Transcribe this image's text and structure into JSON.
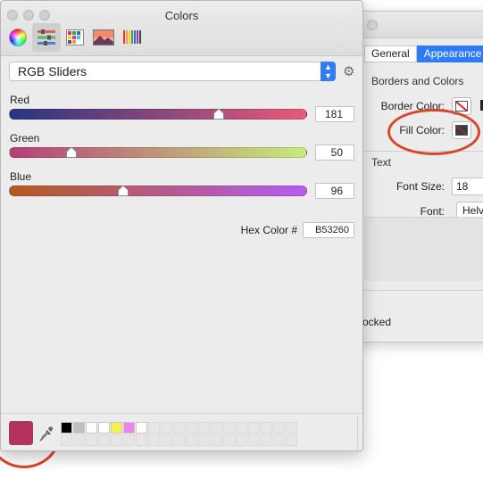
{
  "inspector": {
    "tabs": [
      {
        "label": "General",
        "active": false
      },
      {
        "label": "Appearance",
        "active": true
      }
    ],
    "sections": {
      "borders_and_colors": "Borders and Colors",
      "text": "Text"
    },
    "border_color_label": "Border Color:",
    "fill_color_label": "Fill Color:",
    "font_size_label": "Font Size:",
    "font_size_value": "18",
    "font_label": "Font:",
    "font_value": "Helve",
    "locked_text": "ocked",
    "annotation_color": "#d9462b"
  },
  "colors_panel": {
    "title": "Colors",
    "modes": [
      {
        "icon": "color-wheel-icon",
        "active": false
      },
      {
        "icon": "color-sliders-icon",
        "active": true
      },
      {
        "icon": "color-palettes-icon",
        "active": false
      },
      {
        "icon": "image-palettes-icon",
        "active": false
      },
      {
        "icon": "pencils-icon",
        "active": false
      }
    ],
    "slider_mode": "RGB Sliders",
    "sliders": [
      {
        "label": "Red",
        "value": "181",
        "fraction": 0.71,
        "gradient": [
          "#283580",
          "#e85a7a"
        ]
      },
      {
        "label": "Green",
        "value": "50",
        "fraction": 0.2,
        "gradient": [
          "#b4407a",
          "#c8ec7a"
        ]
      },
      {
        "label": "Blue",
        "value": "96",
        "fraction": 0.38,
        "gradient": [
          "#b55a20",
          "#b55cf0"
        ]
      }
    ],
    "hex_label": "Hex Color #",
    "hex_value": "B53260",
    "current_color": "#b53260",
    "swatches": [
      "#000000",
      "#c0c0c0",
      "#ffffff",
      "#ffffff",
      "#f6f14a",
      "#ee82ee",
      "#ffffff"
    ]
  }
}
